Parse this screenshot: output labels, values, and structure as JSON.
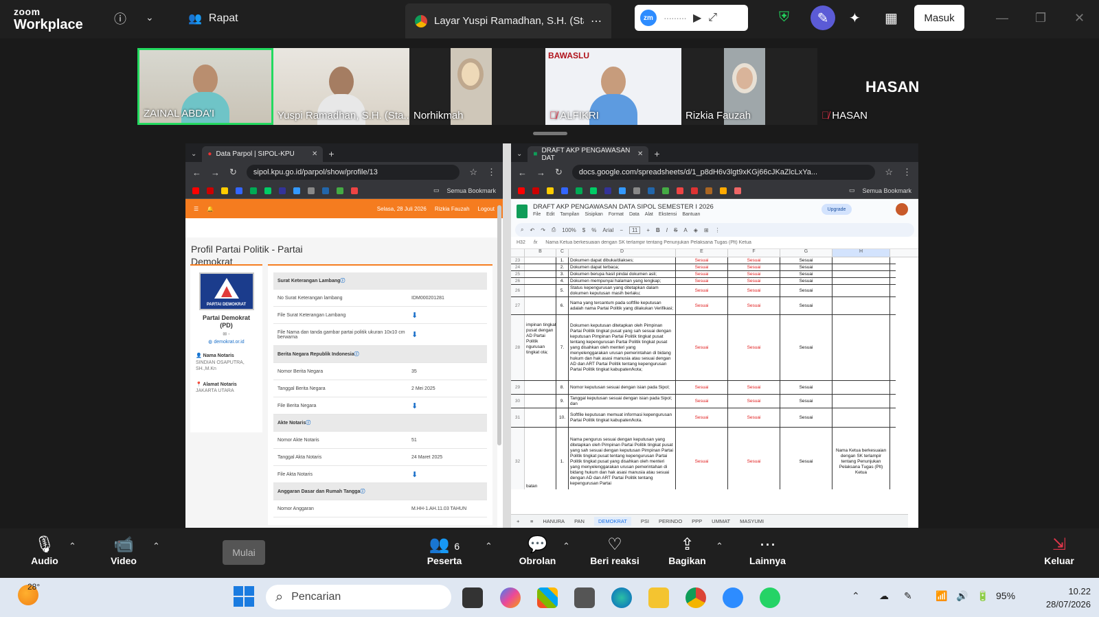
{
  "zoom": {
    "logo_top": "zoom",
    "logo_bottom": "Workplace",
    "meeting_label": "Rapat",
    "share_title": "Layar Yuspi Ramadhan, S.H. (Staf",
    "zm_badge": "zm",
    "sign_in": "Masuk"
  },
  "participants": [
    {
      "name": "ZAINAL ABDA'I"
    },
    {
      "name": "Yuspi Ramadhan, S.H. (Sta..."
    },
    {
      "name": "Norhikmah"
    },
    {
      "name": "ALFIKRI"
    },
    {
      "name": "Rizkia Fauzah"
    },
    {
      "name": "HASAN"
    }
  ],
  "alfikri_bg_text": "BAWASLU",
  "hasan_big": "HASAN",
  "left_browser": {
    "tab_title": "Data Parpol | SIPOL-KPU",
    "url": "sipol.kpu.go.id/parpol/show/profile/13",
    "bookmarks_label": "Semua Bookmark",
    "topbar_date": "Selasa, 28 Juli 2026",
    "topbar_user": "Rizkia Fauzah",
    "topbar_logout": "Logout",
    "page_title": "Profil Partai Politik - Partai Demokrat",
    "party_logo_text": "PARTAI DEMOKRAT",
    "party_name": "Partai Demokrat (PD)",
    "email_dash": "-",
    "website": "demokrat.or.id",
    "notary_name_label": "Nama Notaris",
    "notary_name": "SINDIAN OSAPUTRA, SH.,M.Kn",
    "notary_addr_label": "Alamat Notaris",
    "notary_addr": "JAKARTA UTARA",
    "rows": [
      {
        "k": "Surat Keterangan Lambang",
        "v": "",
        "sec": true
      },
      {
        "k": "No Surat Keterangan lambang",
        "v": "IDM000201281"
      },
      {
        "k": "File Surat Keterangan Lambang",
        "v": "",
        "dl": true
      },
      {
        "k": "File Nama dan tanda gambar partai politik ukuran 10x10 cm berwarna",
        "v": "",
        "dl": true
      },
      {
        "k": "Berita Negara Republik Indonesia",
        "v": "",
        "sec": true
      },
      {
        "k": "Nomor Berita Negara",
        "v": "35"
      },
      {
        "k": "Tanggal Berita Negara",
        "v": "2 Mei 2025"
      },
      {
        "k": "File Berita Negara",
        "v": "",
        "dl": true
      },
      {
        "k": "Akte Notaris",
        "v": "",
        "sec": true
      },
      {
        "k": "Nomor Akte Notaris",
        "v": "51"
      },
      {
        "k": "Tanggal Akta Notaris",
        "v": "24 Maret 2025"
      },
      {
        "k": "File Akta Notaris",
        "v": "",
        "dl": true
      },
      {
        "k": "Anggaran Dasar dan Rumah Tangga",
        "v": "",
        "sec": true
      },
      {
        "k": "Nomor Anggaran",
        "v": "M.HH-1.AH.11.03 TAHUN"
      }
    ]
  },
  "right_browser": {
    "tab_title": "DRAFT AKP PENGAWASAN DAT",
    "url": "docs.google.com/spreadsheets/d/1_p8dH6v3lgt9xKGj66cJKaZlcLxYa...",
    "bookmarks_label": "Semua Bookmark",
    "doc_title": "DRAFT AKP PENGAWASAN DATA SIPOL SEMESTER I 2026",
    "menus": [
      "File",
      "Edit",
      "Tampilan",
      "Sisipkan",
      "Format",
      "Data",
      "Alat",
      "Ekstensi",
      "Bantuan"
    ],
    "upgrade": "Upgrade",
    "zoom_pct": "100%",
    "font": "Arial",
    "font_size": "11",
    "cell_ref": "H32",
    "formula": "Nama Ketua berkesuaian dengan SK terlampir tentang Penunjukan Pelaksana Tugas (Plt) Ketua",
    "columns": [
      "B",
      "C",
      "D",
      "E",
      "F",
      "G",
      "H"
    ],
    "left_label": "impinan tingkat pusat dengan AD Partai Politik ngurusan tingkat ota;",
    "bottom_label": "batan",
    "rows": [
      {
        "rn": "23",
        "no": "1.",
        "d": "Dokumen dapat dibuka/diakses;",
        "e": "Sesuai",
        "f": "Sesuai",
        "g": "Sesuai",
        "h": ""
      },
      {
        "rn": "24",
        "no": "2.",
        "d": "Dokumen dapat terbaca;",
        "e": "Sesuai",
        "f": "Sesuai",
        "g": "Sesuai",
        "h": ""
      },
      {
        "rn": "25",
        "no": "3.",
        "d": "Dokumen berupa hasil pindai dokumen asli;",
        "e": "Sesuai",
        "f": "Sesuai",
        "g": "Sesuai",
        "h": ""
      },
      {
        "rn": "26",
        "no": "4.",
        "d": "Dokumen mempunyai halaman yang lengkap;",
        "e": "Sesuai",
        "f": "Sesuai",
        "g": "Sesuai",
        "h": ""
      },
      {
        "rn": "26",
        "no": "5.",
        "d": "Status kepengurusan yang ditetapkan dalam dokumen keputusan masih berlaku;",
        "e": "Sesuai",
        "f": "Sesuai",
        "g": "Sesuai",
        "h": ""
      },
      {
        "rn": "27",
        "no": "6.",
        "d": "Nama yang tercantum pada softfile keputusan adalah nama Partai Politik yang dilakukan Verifikasi;",
        "e": "Sesuai",
        "f": "Sesuai",
        "g": "Sesuai",
        "h": ""
      },
      {
        "rn": "28",
        "no": "7.",
        "d": "Dokumen keputusan ditetapkan oleh Pimpinan Partai Politik tingkat pusat yang sah sesuai dengan keputusan Pimpinan Partai Politik tingkat pusat tentang kepengurusan Partai Politik tingkat pusat yang disahkan oleh menteri yang menyelenggarakan urusan pemerintahan di bidang hukum dan hak asasi manusia atau sesuai dengan AD dan ART Partai Politik tentang kepengurusan Partai Politik tingkat kabupaten/kota;",
        "e": "Sesuai",
        "f": "Sesuai",
        "g": "Sesuai",
        "h": ""
      },
      {
        "rn": "29",
        "no": "8.",
        "d": "Nomor keputusan sesuai dengan isian pada Sipol;",
        "e": "Sesuai",
        "f": "Sesuai",
        "g": "Sesuai",
        "h": ""
      },
      {
        "rn": "30",
        "no": "9.",
        "d": "Tanggal keputusan sesuai dengan isian pada Sipol; dan",
        "e": "Sesuai",
        "f": "Sesuai",
        "g": "Sesuai",
        "h": ""
      },
      {
        "rn": "31",
        "no": "10.",
        "d": "Softfile keputusan memuat informasi kepengurusan Partai Politik tingkat kabupaten/kota.",
        "e": "Sesuai",
        "f": "Sesuai",
        "g": "Sesuai",
        "h": ""
      },
      {
        "rn": "32",
        "no": "1.",
        "d": "Nama pengurus sesuai dengan keputusan yang ditetapkan oleh Pimpinan Partai Politik tingkat pusat yang sah sesuai dengan keputusan Pimpinan Partai Politik tingkat pusat tentang kepengurusan Partai Politik tingkat pusat yang disahkan oleh menteri yang menyelenggarakan urusan pemerintahan di bidang hukum dan hak asasi manusia atau sesuai dengan AD dan ART Partai Politik tentang kepengurusan Partai",
        "e": "Sesuai",
        "f": "Sesuai",
        "g": "Sesuai",
        "h": "Nama Ketua berkesuaian dengan SK terlampir tentang Penunjukan Pelaksana Tugas (Plt) Ketua"
      }
    ],
    "sheets": [
      "HANURA",
      "PAN",
      "DEMOKRAT",
      "PSI",
      "PERINDO",
      "PPP",
      "UMMAT",
      "MASYUMI"
    ]
  },
  "toolbar": {
    "audio": "Audio",
    "video": "Video",
    "start": "Mulai",
    "participants": "Peserta",
    "participant_count": "6",
    "chat": "Obrolan",
    "react": "Beri reaksi",
    "share": "Bagikan",
    "more": "Lainnya",
    "leave": "Keluar"
  },
  "taskbar": {
    "temp": "28°",
    "search_placeholder": "Pencarian",
    "battery": "95%",
    "time": "10.22",
    "date": "28/07/2026"
  }
}
